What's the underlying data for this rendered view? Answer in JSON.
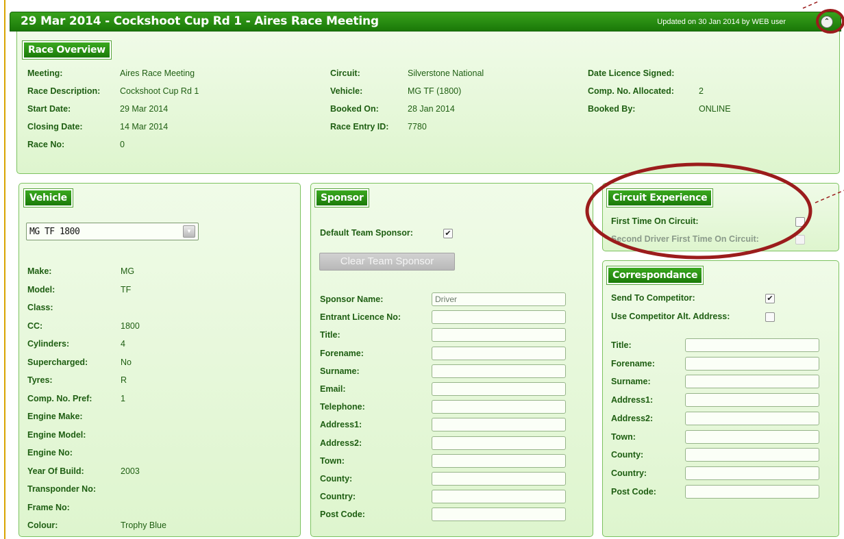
{
  "header": {
    "title": "29 Mar 2014 - Cockshoot Cup Rd 1 - Aires Race Meeting",
    "updated": "Updated on 30 Jan 2014 by WEB user",
    "collapse_icon": "double-chevron-up-icon"
  },
  "overview": {
    "title": "Race Overview",
    "col1": [
      {
        "label": "Meeting:",
        "value": "Aires Race Meeting"
      },
      {
        "label": "Race Description:",
        "value": "Cockshoot Cup Rd 1"
      },
      {
        "label": "Start Date:",
        "value": "29 Mar 2014"
      },
      {
        "label": "Closing Date:",
        "value": "14 Mar 2014"
      },
      {
        "label": "Race No:",
        "value": "0"
      }
    ],
    "col2": [
      {
        "label": "Circuit:",
        "value": "Silverstone National"
      },
      {
        "label": "Vehicle:",
        "value": "MG TF (1800)"
      },
      {
        "label": "Booked On:",
        "value": "28 Jan 2014"
      },
      {
        "label": "Race Entry ID:",
        "value": "7780"
      }
    ],
    "col3": [
      {
        "label": "Date Licence Signed:",
        "value": ""
      },
      {
        "label": "Comp. No. Allocated:",
        "value": "2"
      },
      {
        "label": "Booked By:",
        "value": "ONLINE"
      }
    ]
  },
  "vehicle": {
    "title": "Vehicle",
    "selected": "MG TF 1800",
    "fields": [
      {
        "label": "Make:",
        "value": "MG"
      },
      {
        "label": "Model:",
        "value": "TF"
      },
      {
        "label": "Class:",
        "value": ""
      },
      {
        "label": "CC:",
        "value": "1800"
      },
      {
        "label": "Cylinders:",
        "value": "4"
      },
      {
        "label": "Supercharged:",
        "value": "No"
      },
      {
        "label": "Tyres:",
        "value": "R"
      },
      {
        "label": "Comp. No. Pref:",
        "value": "1"
      },
      {
        "label": "Engine Make:",
        "value": ""
      },
      {
        "label": "Engine Model:",
        "value": ""
      },
      {
        "label": "Engine No:",
        "value": ""
      },
      {
        "label": "Year Of Build:",
        "value": "2003"
      },
      {
        "label": "Transponder No:",
        "value": ""
      },
      {
        "label": "Frame No:",
        "value": ""
      },
      {
        "label": "Colour:",
        "value": "Trophy Blue"
      }
    ]
  },
  "sponsor": {
    "title": "Sponsor",
    "default_label": "Default Team Sponsor:",
    "default_checked": true,
    "clear_button": "Clear Team Sponsor",
    "fields": [
      {
        "label": "Sponsor Name:",
        "value": "Driver"
      },
      {
        "label": "Entrant Licence No:",
        "value": ""
      },
      {
        "label": "Title:",
        "value": ""
      },
      {
        "label": "Forename:",
        "value": ""
      },
      {
        "label": "Surname:",
        "value": ""
      },
      {
        "label": "Email:",
        "value": ""
      },
      {
        "label": "Telephone:",
        "value": ""
      },
      {
        "label": "Address1:",
        "value": ""
      },
      {
        "label": "Address2:",
        "value": ""
      },
      {
        "label": "Town:",
        "value": ""
      },
      {
        "label": "County:",
        "value": ""
      },
      {
        "label": "Country:",
        "value": ""
      },
      {
        "label": "Post Code:",
        "value": ""
      }
    ]
  },
  "circuit": {
    "title": "Circuit Experience",
    "first_label": "First Time On Circuit:",
    "first_checked": false,
    "second_label": "Second Driver First Time On Circuit:",
    "second_checked": false
  },
  "correspondance": {
    "title": "Correspondance",
    "send_label": "Send To Competitor:",
    "send_checked": true,
    "alt_label": "Use Competitor Alt. Address:",
    "alt_checked": false,
    "fields": [
      {
        "label": "Title:",
        "value": ""
      },
      {
        "label": "Forename:",
        "value": ""
      },
      {
        "label": "Surname:",
        "value": ""
      },
      {
        "label": "Address1:",
        "value": ""
      },
      {
        "label": "Address2:",
        "value": ""
      },
      {
        "label": "Town:",
        "value": ""
      },
      {
        "label": "County:",
        "value": ""
      },
      {
        "label": "Country:",
        "value": ""
      },
      {
        "label": "Post Code:",
        "value": ""
      }
    ]
  },
  "colors": {
    "header_green": "#1a7808",
    "panel_bg": "#e6f7d8",
    "text_green": "#1e5e12",
    "annotation_red": "#9b1c1c"
  }
}
